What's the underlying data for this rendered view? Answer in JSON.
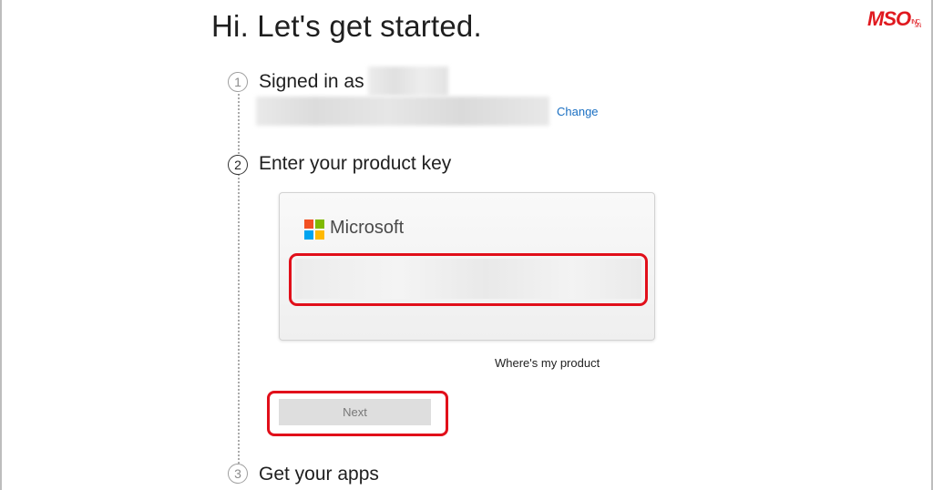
{
  "page": {
    "title": "Hi. Let's get started."
  },
  "watermark": {
    "brand": "MSO",
    "sup": "INC",
    "domain": ".VN"
  },
  "steps": [
    {
      "number": "1",
      "label": "Signed in as",
      "change_link": "Change"
    },
    {
      "number": "2",
      "label": "Enter your product key"
    },
    {
      "number": "3",
      "label": "Get your apps"
    }
  ],
  "product_key": {
    "brand": "Microsoft",
    "input_value": "",
    "where_link": "Where's my product",
    "next_label": "Next"
  },
  "colors": {
    "highlight": "#e10f1a",
    "link": "#1a6fc2",
    "ms_red": "#f25022",
    "ms_green": "#7fba00",
    "ms_blue": "#00a4ef",
    "ms_yellow": "#ffb900"
  },
  "icons": {
    "logo": "microsoft-logo-icon",
    "watermark": "mso-logo-icon"
  }
}
